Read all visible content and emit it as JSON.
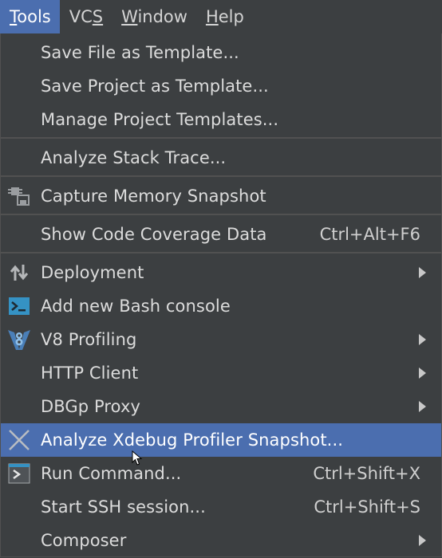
{
  "menubar": {
    "items": [
      {
        "label": "Tools",
        "mnemonic_index": 0
      },
      {
        "label": "VCS",
        "mnemonic_index": 2
      },
      {
        "label": "Window",
        "mnemonic_index": 0
      },
      {
        "label": "Help",
        "mnemonic_index": 0
      }
    ],
    "active": "Tools"
  },
  "menu": {
    "items": [
      {
        "label": "Save File as Template...",
        "shortcut": "",
        "icon": "",
        "submenu": false
      },
      {
        "label": "Save Project as Template...",
        "shortcut": "",
        "icon": "",
        "submenu": false
      },
      {
        "label": "Manage Project Templates...",
        "shortcut": "",
        "icon": "",
        "submenu": false
      },
      {
        "label": "Analyze Stack Trace...",
        "shortcut": "",
        "icon": "",
        "submenu": false
      },
      {
        "label": "Capture Memory Snapshot",
        "shortcut": "",
        "icon": "memory-snapshot-icon",
        "submenu": false
      },
      {
        "label": "Show Code Coverage Data",
        "shortcut": "Ctrl+Alt+F6",
        "icon": "",
        "submenu": false
      },
      {
        "label": "Deployment",
        "shortcut": "",
        "icon": "deployment-arrows-icon",
        "submenu": true
      },
      {
        "label": "Add new Bash console",
        "shortcut": "",
        "icon": "terminal-icon",
        "submenu": false
      },
      {
        "label": "V8 Profiling",
        "shortcut": "",
        "icon": "v8-icon",
        "submenu": true
      },
      {
        "label": "HTTP Client",
        "shortcut": "",
        "icon": "",
        "submenu": true
      },
      {
        "label": "DBGp Proxy",
        "shortcut": "",
        "icon": "",
        "submenu": true
      },
      {
        "label": "Analyze Xdebug Profiler Snapshot...",
        "shortcut": "",
        "icon": "xdebug-icon",
        "submenu": false,
        "selected": true
      },
      {
        "label": "Run Command...",
        "shortcut": "Ctrl+Shift+X",
        "icon": "run-command-icon",
        "submenu": false
      },
      {
        "label": "Start SSH session...",
        "shortcut": "Ctrl+Shift+S",
        "icon": "",
        "submenu": false
      },
      {
        "label": "Composer",
        "shortcut": "",
        "icon": "",
        "submenu": true
      }
    ]
  },
  "colors": {
    "background": "#3c3f41",
    "selection": "#4b6eaf",
    "separator": "#515151",
    "text": "#dcdcdc"
  }
}
